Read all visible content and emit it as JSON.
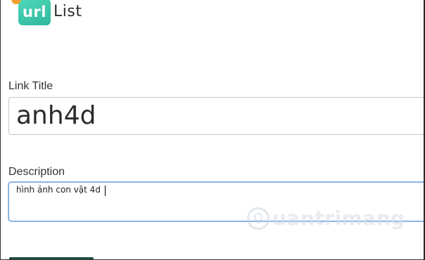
{
  "logo": {
    "badge_text": "url",
    "text": "List",
    "badge_color": "#3cc9a9",
    "dot_color": "#f4a02a"
  },
  "form": {
    "title_label": "Link Title",
    "title_value": "anh4d",
    "description_label": "Description",
    "description_value": "hình ảnh con vật 4d"
  },
  "watermark": {
    "text": "uantrimang",
    "icon": "lightbulb-icon"
  }
}
